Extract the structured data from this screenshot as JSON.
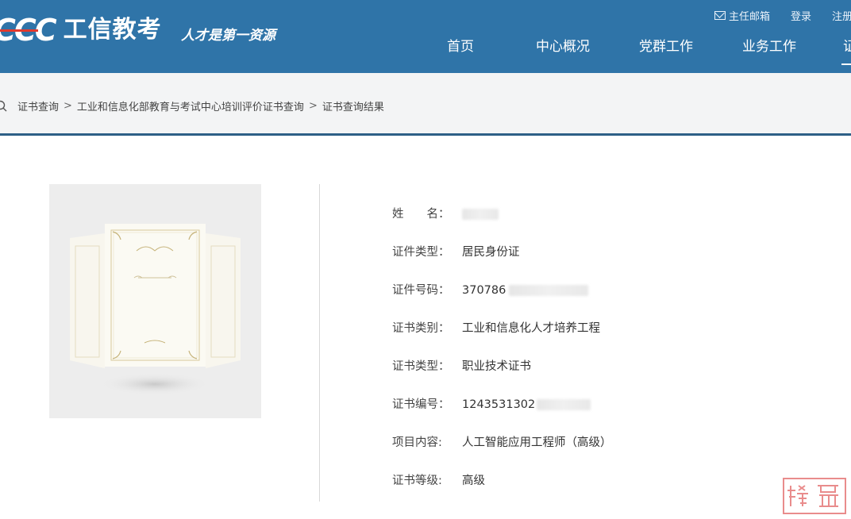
{
  "header": {
    "logo_mark": "CCC",
    "logo_text": "工信教考",
    "slogan": "人才是第一资源",
    "toplinks": {
      "mailbox": "主任邮箱",
      "login": "登录",
      "register": "注册"
    },
    "nav": [
      "首页",
      "中心概况",
      "党群工作",
      "业务工作",
      "证"
    ],
    "colors": {
      "header_bg": "#2f74a8",
      "logo_accent": "#e23a2e"
    }
  },
  "breadcrumb": {
    "items": [
      "证书查询",
      "工业和信息化部教育与考试中心培训评价证书查询",
      "证书查询结果"
    ],
    "separator": ">",
    "icon": "search-icon"
  },
  "certificate": {
    "rows": [
      {
        "label": "姓　　名：",
        "value": ""
      },
      {
        "label": "证件类型：",
        "value": "居民身份证"
      },
      {
        "label": "证件号码：",
        "value": "370786"
      },
      {
        "label": "证书类别：",
        "value": "工业和信息化人才培养工程"
      },
      {
        "label": "证书类型：",
        "value": "职业技术证书"
      },
      {
        "label": "证书编号：",
        "value": "1243531302"
      },
      {
        "label": "项目内容:",
        "value": "人工智能应用工程师（高级）"
      },
      {
        "label": "证书等级:",
        "value": "高级"
      }
    ]
  },
  "watermark": {
    "icon": "red-stamp-seal"
  }
}
